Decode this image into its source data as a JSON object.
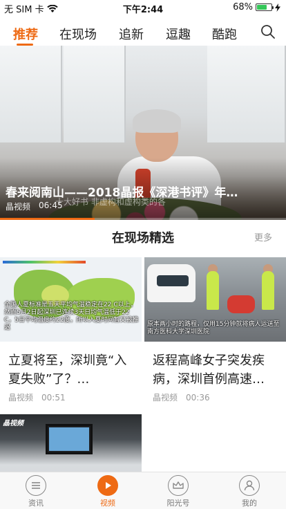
{
  "status_bar": {
    "carrier": "无 SIM 卡",
    "time": "下午2:44",
    "battery_percent": "68%",
    "battery_level": 0.68
  },
  "tabs": [
    {
      "label": "推荐",
      "active": true
    },
    {
      "label": "在现场",
      "active": false
    },
    {
      "label": "追新",
      "active": false
    },
    {
      "label": "逗趣",
      "active": false
    },
    {
      "label": "酷跑",
      "active": false
    }
  ],
  "hero": {
    "title": "春来阅南山——2018晶报《深港书评》年…",
    "source": "晶视频",
    "duration": "06:45",
    "caption": "十大好书 非虚构和虚构类的各",
    "progress": 0.33
  },
  "section": {
    "title": "在现场精选",
    "more": "更多"
  },
  "cards": [
    {
      "title": "立夏将至，深圳竟“入夏失败”了？…",
      "source": "晶视频",
      "duration": "00:51",
      "thumb_text": "全国人夏标准是五天平均气温稳定在22 C以上，然而5月2日起深圳已连续3天日均气温低于22 C，5日平均温度约22度，所以入夏时间暂又被推迟"
    },
    {
      "title": "返程高峰女子突发疾病，深圳首例高速…",
      "source": "晶视频",
      "duration": "00:36",
      "thumb_text": "原本两小时的路程，仅用15分钟就将病人运送至南方医科大学深圳医院"
    },
    {
      "title": "",
      "source": "",
      "duration": "",
      "thumb_text": "晶视频"
    }
  ],
  "bottom_nav": [
    {
      "label": "资讯",
      "icon": "list-icon",
      "active": false
    },
    {
      "label": "视频",
      "icon": "play-icon",
      "active": true
    },
    {
      "label": "阳光号",
      "icon": "crown-icon",
      "active": false
    },
    {
      "label": "我的",
      "icon": "user-icon",
      "active": false
    }
  ],
  "colors": {
    "accent": "#ee6a14",
    "muted": "#999999"
  }
}
